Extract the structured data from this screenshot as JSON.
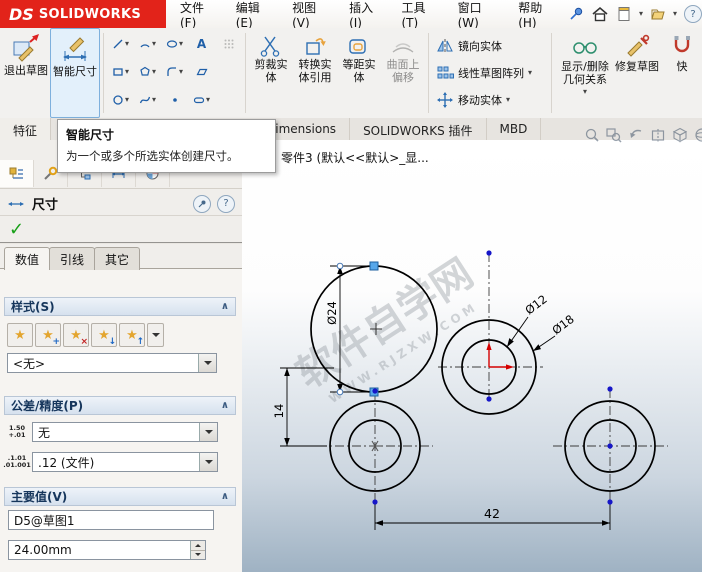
{
  "titlebar": {
    "brand": {
      "ds": "DS",
      "name": "SOLIDWORKS"
    },
    "menus": [
      "文件(F)",
      "编辑(E)",
      "视图(V)",
      "插入(I)",
      "工具(T)",
      "窗口(W)",
      "帮助(H)"
    ]
  },
  "ribbon": {
    "exit_sketch": "退出草图",
    "smart_dimension": "智能尺寸",
    "trim_entities": "剪裁实体",
    "convert_entities": "转换实体引用",
    "offset_entities": "等距实体",
    "offset_on_surface": "曲面上偏移",
    "mirror_entities": "镜向实体",
    "linear_sketch_pattern": "线性草图阵列",
    "move_entities": "移动实体",
    "display_delete_relations": "显示/删除几何关系",
    "repair_sketch": "修复草图",
    "quick_snaps": "快"
  },
  "command_tabs": [
    "特征",
    "Dimensions",
    "SOLIDWORKS 插件",
    "MBD"
  ],
  "tooltip": {
    "title": "智能尺寸",
    "body": "为一个或多个所选实体创建尺寸。"
  },
  "panel": {
    "title": "尺寸",
    "value_tabs": [
      "数值",
      "引线",
      "其它"
    ],
    "style_section": {
      "label": "样式(S)",
      "selected": "<无>"
    },
    "tolerance_section": {
      "label": "公差/精度(P)",
      "tolerance_value": "无",
      "precision_value": ".12 (文件)",
      "tolerance_icon_top": "1.50",
      "tolerance_icon_bottom": "+.01",
      "precision_icon_top": ".1.01",
      "precision_icon_bottom": ".01.001"
    },
    "primary_section": {
      "label": "主要值(V)",
      "dim_name": "D5@草图1",
      "dim_value": "24.00mm"
    }
  },
  "graphics": {
    "document_label": "零件3 (默认<<默认>_显...",
    "watermark_line1": "软件自学网",
    "watermark_line2": "WWW.RJZXW.COM",
    "dim_d24": "Ø24",
    "dim_d12": "Ø12",
    "dim_d18": "Ø18",
    "dim_14": "14",
    "dim_42": "42"
  },
  "icons": {
    "caret_down": "▾",
    "chevron_up": "∧",
    "text_tool": "A",
    "question": "?",
    "star": "★",
    "plus": "+",
    "cross": "×",
    "arrow_down": "↓",
    "arrow_up": "↑",
    "ok_check": "✓"
  }
}
